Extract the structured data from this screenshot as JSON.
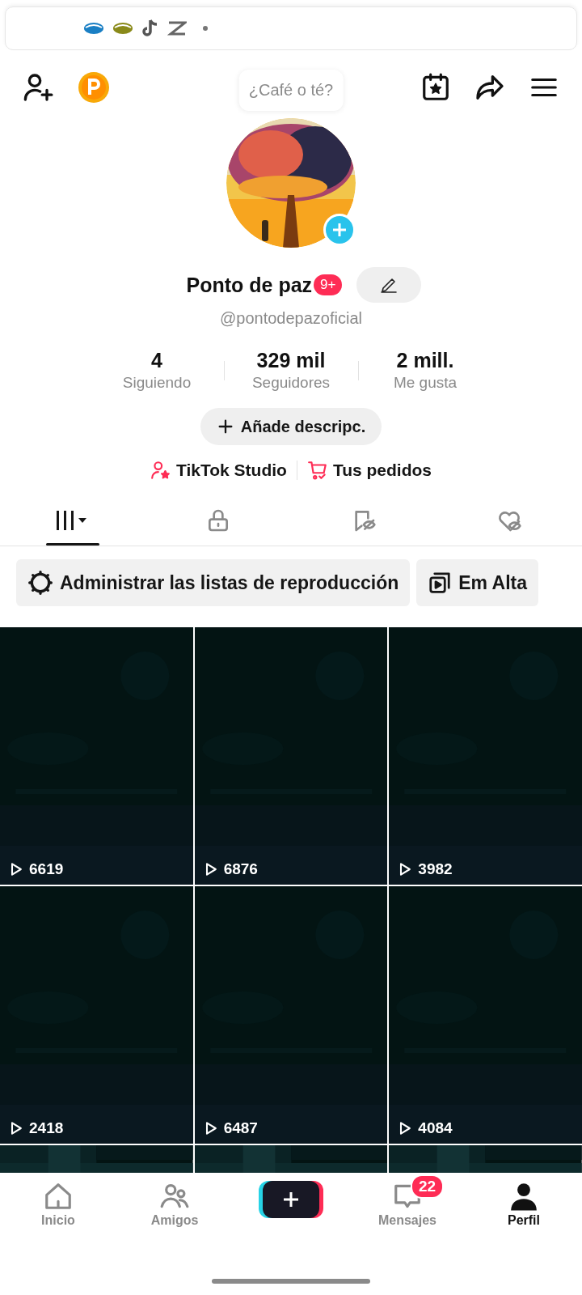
{
  "profile": {
    "tooltip": "¿Café o té?",
    "name": "Ponto de paz",
    "name_badge": "9+",
    "handle": "@pontodepazoficial"
  },
  "stats": [
    {
      "value": "4",
      "label": "Siguiendo"
    },
    {
      "value": "329 mil",
      "label": "Seguidores"
    },
    {
      "value": "2 mill.",
      "label": "Me gusta"
    }
  ],
  "description_button": "Añade descripc.",
  "links": [
    {
      "kind": "studio",
      "label": "TikTok Studio"
    },
    {
      "kind": "orders",
      "label": "Tus pedidos"
    }
  ],
  "tabs": [
    {
      "kind": "videos",
      "selected": true
    },
    {
      "kind": "private",
      "selected": false
    },
    {
      "kind": "saved",
      "selected": false
    },
    {
      "kind": "liked",
      "selected": false
    }
  ],
  "chips": [
    {
      "kind": "playlists",
      "label": "Administrar las listas de reproducción"
    },
    {
      "kind": "featured",
      "label": "Em Alta"
    }
  ],
  "videos": [
    {
      "views": "6619"
    },
    {
      "views": "6876"
    },
    {
      "views": "3982"
    },
    {
      "views": "2418"
    },
    {
      "views": "6487"
    },
    {
      "views": "4084"
    },
    {
      "kind": "picture"
    },
    {
      "kind": "picture"
    },
    {
      "kind": "picture"
    }
  ],
  "nav": [
    {
      "kind": "home",
      "label": "Inicio",
      "selected": false
    },
    {
      "kind": "friends",
      "label": "Amigos",
      "selected": false
    },
    {
      "kind": "create",
      "selected": false
    },
    {
      "kind": "inbox",
      "label": "Mensajes",
      "badge": "22",
      "selected": false
    },
    {
      "kind": "profile",
      "label": "Perfil",
      "selected": true
    }
  ]
}
